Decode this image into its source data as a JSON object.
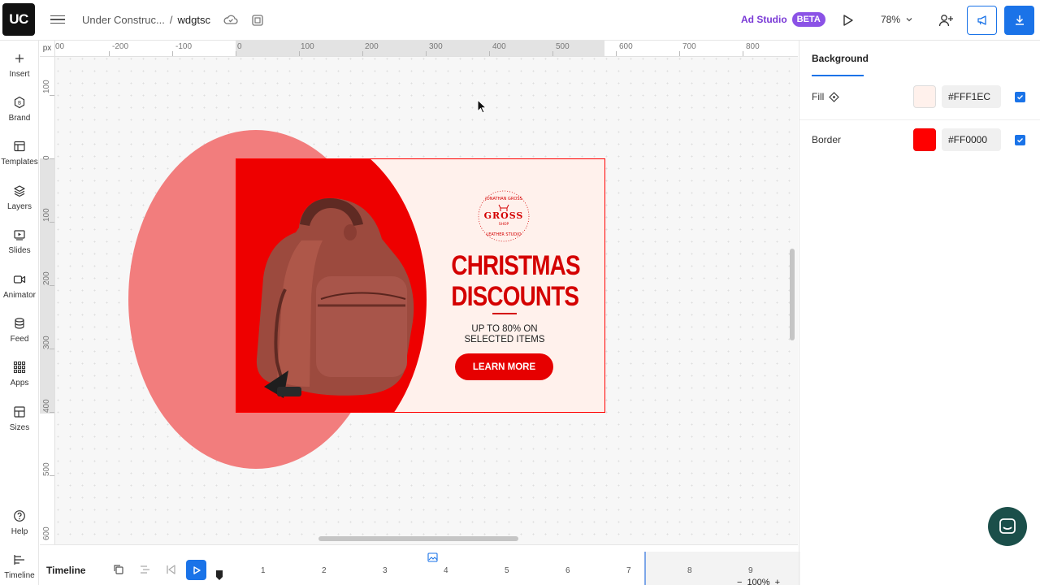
{
  "app": {
    "logo_text": "UC"
  },
  "header": {
    "breadcrumb_parent": "Under Construc...",
    "breadcrumb_sep": "/",
    "breadcrumb_current": "wdgtsc",
    "adstudio_label": "Ad Studio",
    "beta_badge": "BETA",
    "zoom_value": "78%"
  },
  "sidebar": {
    "items": [
      {
        "label": "Insert",
        "icon": "plus-icon"
      },
      {
        "label": "Brand",
        "icon": "brand-icon"
      },
      {
        "label": "Templates",
        "icon": "templates-icon"
      },
      {
        "label": "Layers",
        "icon": "layers-icon"
      },
      {
        "label": "Slides",
        "icon": "slides-icon"
      },
      {
        "label": "Animator",
        "icon": "animator-icon"
      },
      {
        "label": "Feed",
        "icon": "feed-icon"
      },
      {
        "label": "Apps",
        "icon": "apps-icon"
      },
      {
        "label": "Sizes",
        "icon": "sizes-icon"
      },
      {
        "label": "Help",
        "icon": "help-icon"
      },
      {
        "label": "Timeline",
        "icon": "timeline-icon"
      }
    ]
  },
  "canvas": {
    "unit": "px",
    "ruler_top": [
      "00",
      "-200",
      "-100",
      "0",
      "100",
      "200",
      "300",
      "400",
      "500",
      "600",
      "700",
      "800"
    ],
    "ruler_left": [
      "100",
      "0",
      "100",
      "200",
      "300",
      "400",
      "500",
      "600"
    ]
  },
  "ad": {
    "brand_top": "JONATHAN GROSS",
    "brand_name": "GROSS",
    "brand_mid": "SHOP",
    "brand_bottom": "LEATHER STUDIO",
    "headline_1": "CHRISTMAS",
    "headline_2": "DISCOUNTS",
    "sub_1": "UP TO 80% ON",
    "sub_2": "SELECTED ITEMS",
    "cta": "LEARN MORE",
    "colors": {
      "background": "#FFF1EC",
      "accent": "#EE0000",
      "ellipse": "#F27D7D"
    }
  },
  "panel": {
    "tab": "Background",
    "fill_label": "Fill",
    "fill_hex": "#FFF1EC",
    "fill_checked": true,
    "border_label": "Border",
    "border_hex": "#FF0000",
    "border_checked": true
  },
  "timeline": {
    "title": "Timeline",
    "ticks": [
      "1",
      "2",
      "3",
      "4",
      "5",
      "6",
      "7",
      "8",
      "9"
    ],
    "zoom": "100%",
    "minus": "−",
    "plus": "+"
  }
}
